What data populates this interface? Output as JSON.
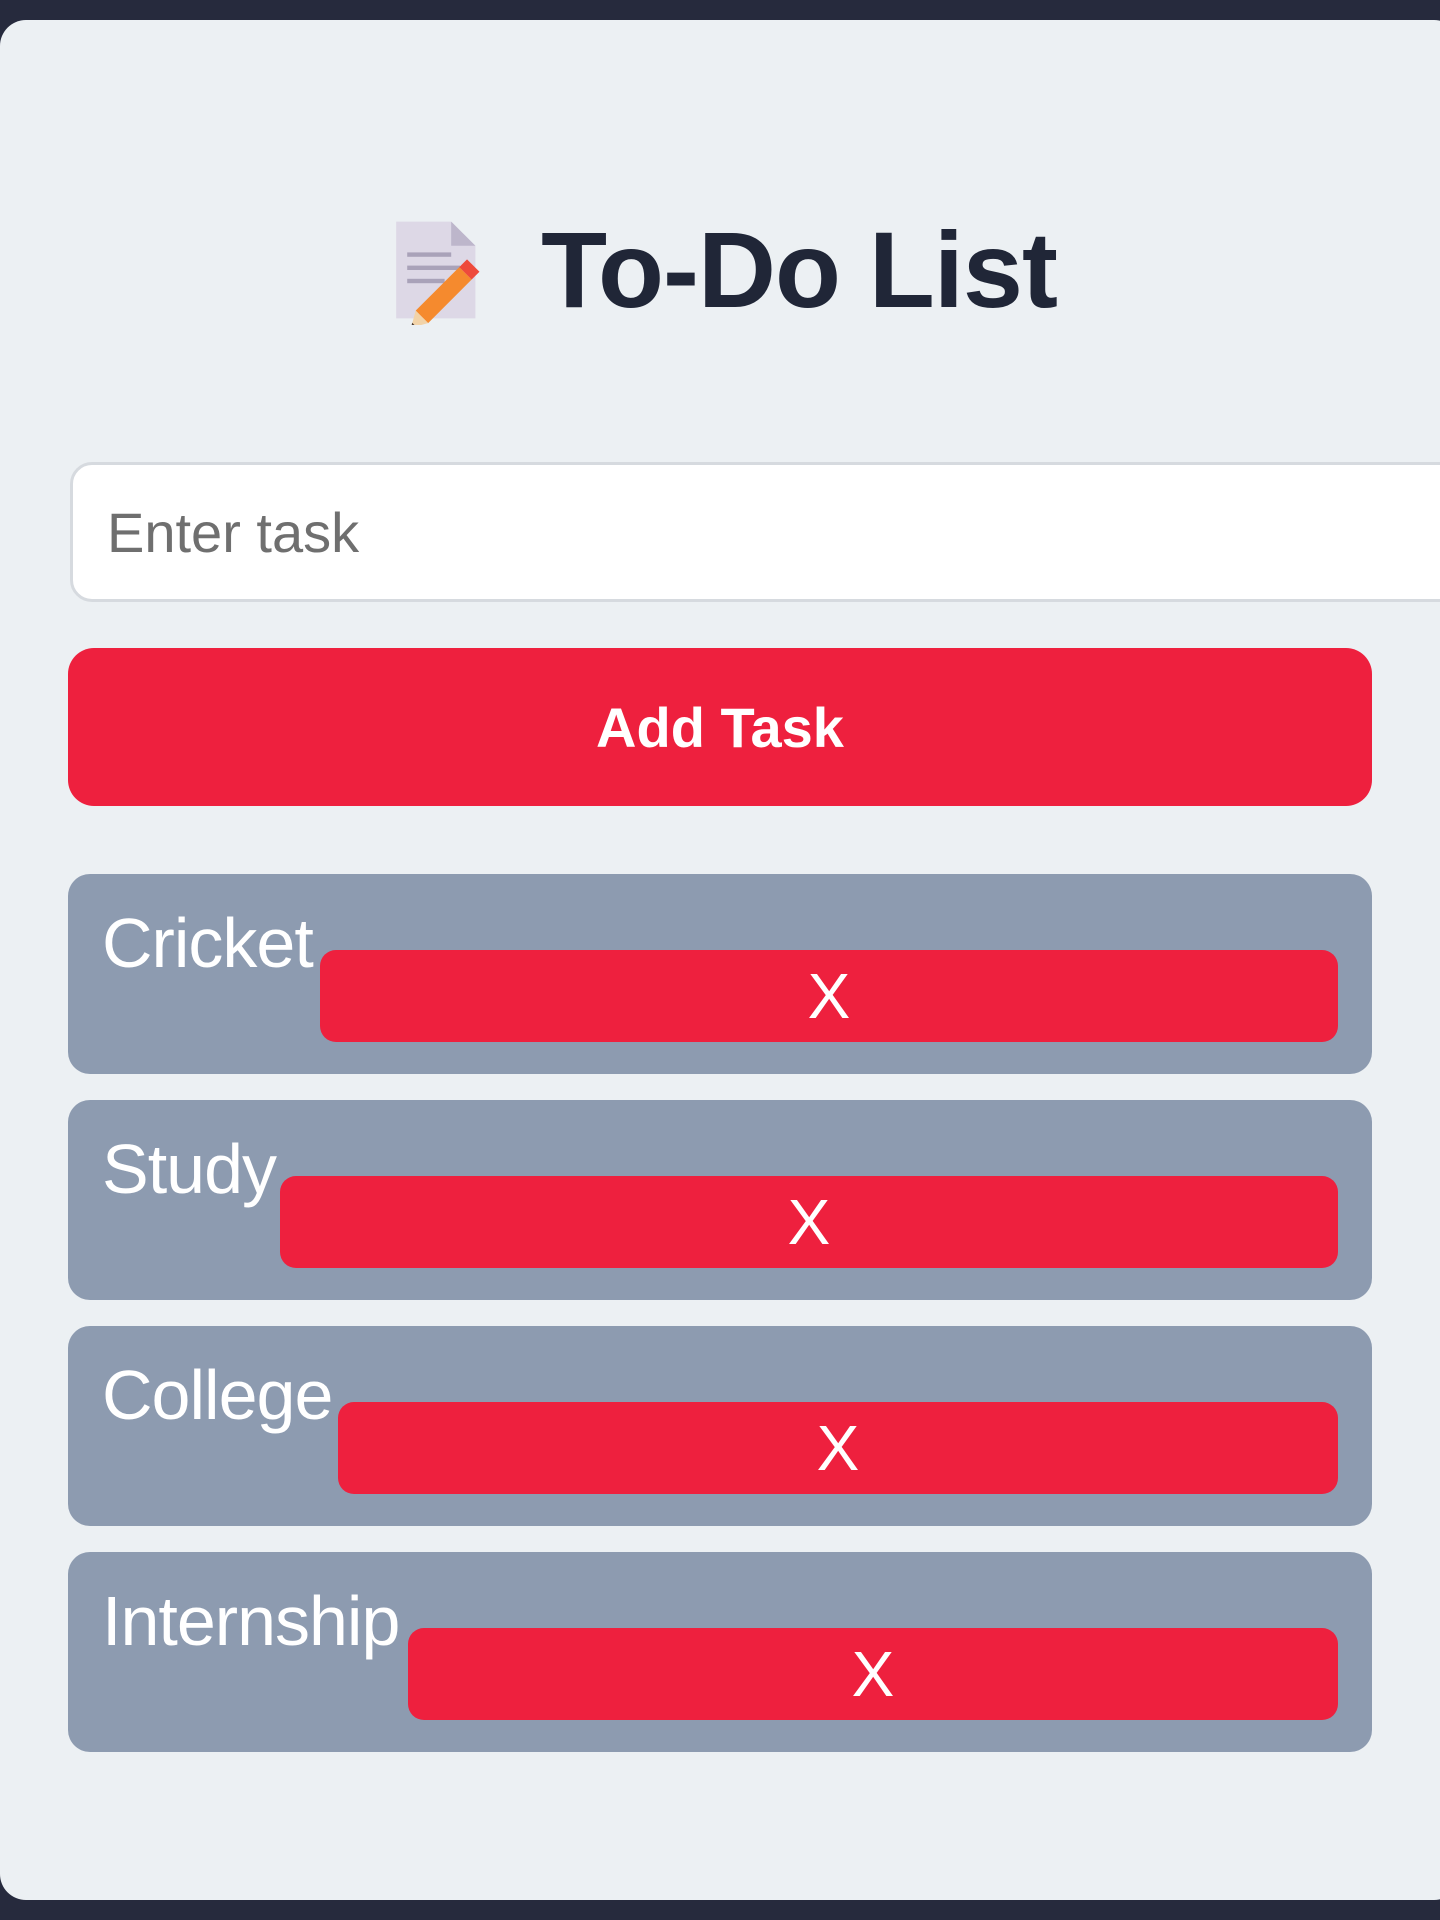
{
  "app": {
    "title": "To-Do List",
    "title_icon": "memo-pencil-icon"
  },
  "input": {
    "placeholder": "Enter task",
    "value": ""
  },
  "add_button": {
    "label": "Add Task"
  },
  "tasks": [
    {
      "label": "Cricket",
      "delete_label": "X"
    },
    {
      "label": "Study",
      "delete_label": "X"
    },
    {
      "label": "College",
      "delete_label": "X"
    },
    {
      "label": "Internship",
      "delete_label": "X"
    }
  ],
  "colors": {
    "accent": "#ee203e",
    "task_bg": "#8d9bb0",
    "card_bg": "#ecf0f3",
    "frame_bg": "#262a3d",
    "title_text": "#202637"
  }
}
